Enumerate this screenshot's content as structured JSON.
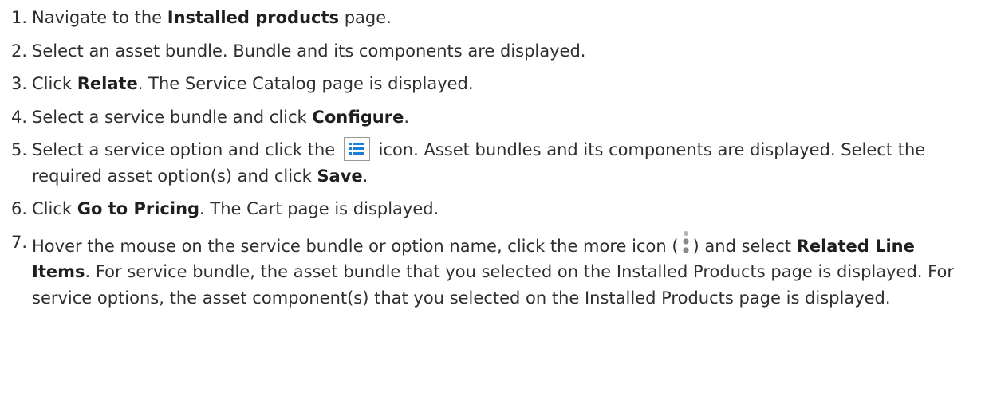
{
  "steps": [
    {
      "num": "1.",
      "parts": [
        "Navigate to the ",
        "Installed products",
        " page."
      ]
    },
    {
      "num": "2.",
      "parts": [
        "Select an asset bundle. Bundle and its components are displayed."
      ]
    },
    {
      "num": "3.",
      "parts": [
        "Click ",
        "Relate",
        ". The Service Catalog page is displayed."
      ]
    },
    {
      "num": "4.",
      "parts": [
        "Select a service bundle and click ",
        "Configure",
        "."
      ]
    },
    {
      "num": "5.",
      "parts": [
        "Select a service option and click the ",
        " icon. Asset bundles and its components are displayed. Select the required asset option(s) and click ",
        "Save",
        "."
      ],
      "icon": "list-icon",
      "icon_color": "#1a7fd4"
    },
    {
      "num": "6.",
      "parts": [
        "Click ",
        "Go to Pricing",
        ". The Cart page is displayed."
      ]
    },
    {
      "num": "7.",
      "parts": [
        "Hover the mouse on the service bundle or option name, click the more icon (",
        ") and select ",
        "Related Line Items",
        ". For service bundle, the asset bundle that you selected on the Installed Products page is displayed. For service options, the asset component(s) that you selected on the Installed Products page is displayed."
      ],
      "icon": "more-vertical-icon"
    }
  ]
}
